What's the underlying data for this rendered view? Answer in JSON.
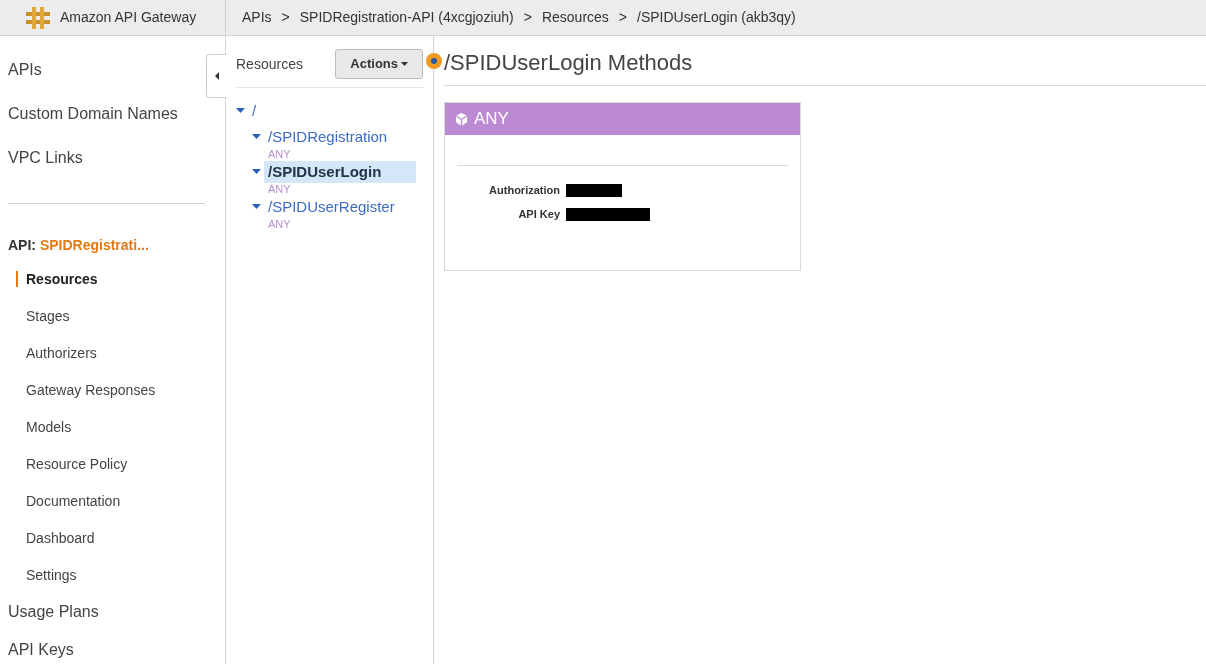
{
  "top_bar": {
    "service": "Amazon API Gateway",
    "breadcrumbs": [
      "APIs",
      "SPIDRegistration-API (4xcgjoziuh)",
      "Resources",
      "/SPIDUserLogin (akb3qy)"
    ],
    "separator": ">"
  },
  "sidebar": {
    "items": [
      {
        "label": "APIs",
        "selected": false
      },
      {
        "label": "Custom Domain Names",
        "selected": false
      },
      {
        "label": "VPC Links",
        "selected": false
      }
    ],
    "api_label": "API:",
    "api_name": "SPIDRegistrati...",
    "api_items": [
      {
        "label": "Resources",
        "selected": true
      },
      {
        "label": "Stages",
        "selected": false
      },
      {
        "label": "Authorizers",
        "selected": false
      },
      {
        "label": "Gateway Responses",
        "selected": false
      },
      {
        "label": "Models",
        "selected": false
      },
      {
        "label": "Resource Policy",
        "selected": false
      },
      {
        "label": "Documentation",
        "selected": false
      },
      {
        "label": "Dashboard",
        "selected": false
      },
      {
        "label": "Settings",
        "selected": false
      }
    ],
    "bottom_items": [
      {
        "label": "Usage Plans",
        "selected": false
      },
      {
        "label": "API Keys",
        "selected": false
      }
    ]
  },
  "resources": {
    "title": "Resources",
    "actions_button": "Actions",
    "tree": [
      {
        "path": "/",
        "expanded": true,
        "selected": false,
        "children": [
          {
            "path": "/SPIDRegistration",
            "expanded": true,
            "selected": false,
            "methods": [
              "ANY"
            ]
          },
          {
            "path": "/SPIDUserLogin",
            "expanded": true,
            "selected": true,
            "methods": [
              "ANY"
            ]
          },
          {
            "path": "/SPIDUserRegister",
            "expanded": true,
            "selected": false,
            "methods": [
              "ANY"
            ]
          }
        ]
      }
    ]
  },
  "main": {
    "title": "/SPIDUserLogin Methods",
    "method_card": {
      "method": "ANY",
      "fields": [
        {
          "label": "Authorization",
          "redacted": true
        },
        {
          "label": "API Key",
          "redacted": true
        }
      ]
    }
  }
}
